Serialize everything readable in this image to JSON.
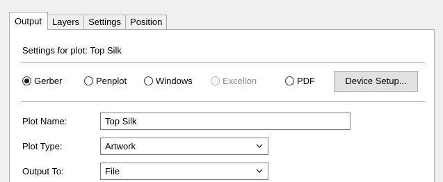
{
  "tabs": [
    {
      "label": "Output",
      "active": true
    },
    {
      "label": "Layers",
      "active": false
    },
    {
      "label": "Settings",
      "active": false
    },
    {
      "label": "Position",
      "active": false
    }
  ],
  "settings_heading": "Settings for plot: Top Silk",
  "format_options": [
    {
      "label": "Gerber",
      "selected": true,
      "enabled": true
    },
    {
      "label": "Penplot",
      "selected": false,
      "enabled": true
    },
    {
      "label": "Windows",
      "selected": false,
      "enabled": true
    },
    {
      "label": "Excellon",
      "selected": false,
      "enabled": false
    },
    {
      "label": "PDF",
      "selected": false,
      "enabled": true
    }
  ],
  "device_setup_label": "Device Setup...",
  "plot_name": {
    "label": "Plot Name:",
    "value": "Top Silk"
  },
  "plot_type": {
    "label": "Plot Type:",
    "value": "Artwork"
  },
  "output_to": {
    "label": "Output To:",
    "value": "File"
  },
  "colors": {
    "accent_border": "#adadad",
    "disabled_text": "#8d8d8d"
  },
  "icons": {
    "dropdown": "chevron-down-icon",
    "radio": "radio-icon"
  }
}
